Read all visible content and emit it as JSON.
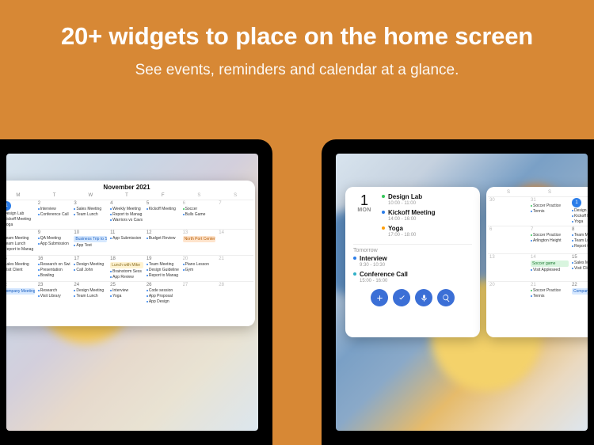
{
  "hero": {
    "title": "20+ widgets to place on the home screen",
    "subtitle": "See events, reminders and calendar at a glance."
  },
  "month": {
    "title": "November 2021",
    "dayHeaders": [
      "M",
      "T",
      "W",
      "T",
      "F",
      "S",
      "S"
    ],
    "weeks": [
      [
        {
          "n": "1",
          "today": true,
          "items": [
            {
              "t": "Design Lab",
              "k": "ev"
            },
            {
              "t": "Kickoff Meeting",
              "k": "ev"
            },
            {
              "t": "Yoga",
              "k": "ev"
            }
          ]
        },
        {
          "n": "2",
          "items": [
            {
              "t": "Interview",
              "k": "ev"
            },
            {
              "t": "Conference Call",
              "k": "ev"
            }
          ]
        },
        {
          "n": "3",
          "items": [
            {
              "t": "Sales Meeting",
              "k": "ev"
            },
            {
              "t": "Team Lunch",
              "k": "ev"
            }
          ]
        },
        {
          "n": "4",
          "items": [
            {
              "t": "Weekly Meeting",
              "k": "ev"
            },
            {
              "t": "Report to Manag",
              "k": "ev"
            },
            {
              "t": "Warriors vs Cavs",
              "k": "ev"
            }
          ]
        },
        {
          "n": "5",
          "items": [
            {
              "t": "Kickoff Meeting",
              "k": "ev"
            }
          ]
        },
        {
          "n": "6",
          "weekend": true,
          "items": [
            {
              "t": "Soccer",
              "k": "ev green"
            },
            {
              "t": "Bulls Game",
              "k": "ev"
            }
          ]
        },
        {
          "n": "7",
          "weekend": true,
          "items": []
        }
      ],
      [
        {
          "n": "8",
          "items": [
            {
              "t": "Team Meeting",
              "k": "ev"
            },
            {
              "t": "Team Lunch",
              "k": "ev"
            },
            {
              "t": "Report to Manag",
              "k": "ev"
            }
          ]
        },
        {
          "n": "9",
          "items": [
            {
              "t": "QA Meeting",
              "k": "ev"
            },
            {
              "t": "App Submission",
              "k": "ev"
            }
          ]
        },
        {
          "n": "10",
          "items": [
            {
              "t": "Business Trip to San Francisco",
              "k": "bar blue",
              "span": 3
            },
            {
              "t": "App Test",
              "k": "ev"
            }
          ]
        },
        {
          "n": "11",
          "items": [
            {
              "t": "App Submission",
              "k": "ev"
            }
          ]
        },
        {
          "n": "12",
          "items": [
            {
              "t": "Budget Review",
              "k": "ev"
            }
          ]
        },
        {
          "n": "13",
          "weekend": true,
          "items": [
            {
              "t": "North Port Center",
              "k": "bar orange"
            }
          ]
        },
        {
          "n": "14",
          "weekend": true,
          "items": []
        }
      ],
      [
        {
          "n": "15",
          "items": [
            {
              "t": "Sales Meeting",
              "k": "ev"
            },
            {
              "t": "Visit Client",
              "k": "ev"
            }
          ]
        },
        {
          "n": "16",
          "items": [
            {
              "t": "Research on Swi",
              "k": "ev"
            },
            {
              "t": "Presentation",
              "k": "ev"
            },
            {
              "t": "Bowling",
              "k": "ev"
            }
          ]
        },
        {
          "n": "17",
          "items": [
            {
              "t": "Design Meeting",
              "k": "ev"
            },
            {
              "t": "Call John",
              "k": "ev"
            }
          ]
        },
        {
          "n": "18",
          "items": [
            {
              "t": "Lunch with Mike",
              "k": "bar yellow"
            },
            {
              "t": "Brainstorm Sess",
              "k": "ev"
            },
            {
              "t": "App Review",
              "k": "ev"
            }
          ]
        },
        {
          "n": "19",
          "items": [
            {
              "t": "Team Meeting",
              "k": "ev"
            },
            {
              "t": "Design Guideline",
              "k": "ev"
            },
            {
              "t": "Report to Manag",
              "k": "ev"
            }
          ]
        },
        {
          "n": "20",
          "weekend": true,
          "items": [
            {
              "t": "Piano Lesson",
              "k": "ev"
            },
            {
              "t": "Gym",
              "k": "ev"
            }
          ]
        },
        {
          "n": "21",
          "weekend": true,
          "items": []
        }
      ],
      [
        {
          "n": "22",
          "items": [
            {
              "t": "Company Meeting",
              "k": "bar blue"
            }
          ]
        },
        {
          "n": "23",
          "items": [
            {
              "t": "Research",
              "k": "ev"
            },
            {
              "t": "Visit Library",
              "k": "ev"
            }
          ]
        },
        {
          "n": "24",
          "items": [
            {
              "t": "Design Meeting",
              "k": "ev"
            },
            {
              "t": "Team Lunch",
              "k": "ev"
            }
          ]
        },
        {
          "n": "25",
          "items": [
            {
              "t": "Interview",
              "k": "ev"
            },
            {
              "t": "Yoga",
              "k": "ev"
            }
          ]
        },
        {
          "n": "26",
          "items": [
            {
              "t": "Code session",
              "k": "ev"
            },
            {
              "t": "App Proposal",
              "k": "ev"
            },
            {
              "t": "App Design",
              "k": "ev"
            }
          ]
        },
        {
          "n": "27",
          "weekend": true,
          "items": []
        },
        {
          "n": "28",
          "weekend": true,
          "items": []
        }
      ]
    ]
  },
  "agenda": {
    "dayNumber": "1",
    "dayOfWeek": "MON",
    "today": [
      {
        "title": "Design Lab",
        "time": "10:00 - 11:00",
        "color": "green"
      },
      {
        "title": "Kickoff Meeting",
        "time": "14:00 - 16:00",
        "color": "blue"
      },
      {
        "title": "Yoga",
        "time": "17:00 - 18:00",
        "color": "orange"
      }
    ],
    "tomorrowLabel": "Tomorrow",
    "tomorrow": [
      {
        "title": "Interview",
        "time": "9:30 - 10:30",
        "color": "blue"
      },
      {
        "title": "Conference Call",
        "time": "15:00 - 16:00",
        "color": "teal"
      }
    ],
    "actions": [
      "plus",
      "check",
      "mic",
      "search"
    ]
  },
  "mini": {
    "headers": [
      "S",
      "S",
      "M"
    ],
    "rows": [
      [
        {
          "n": "30",
          "weekend": true,
          "items": []
        },
        {
          "n": "31",
          "weekend": true,
          "items": [
            {
              "t": "Soccer Practice",
              "k": "ev green"
            },
            {
              "t": "Tennis",
              "k": "ev"
            }
          ]
        },
        {
          "n": "1",
          "today": true,
          "items": [
            {
              "t": "Design Lab",
              "k": "ev"
            },
            {
              "t": "Kickoff Meeting",
              "k": "ev"
            },
            {
              "t": "Yoga",
              "k": "ev"
            }
          ]
        }
      ],
      [
        {
          "n": "6",
          "weekend": true,
          "items": []
        },
        {
          "n": "7",
          "weekend": true,
          "items": [
            {
              "t": "Soccer Practice",
              "k": "ev green"
            },
            {
              "t": "Arlington Height",
              "k": "ev"
            }
          ]
        },
        {
          "n": "8",
          "items": [
            {
              "t": "Team Meeting",
              "k": "ev"
            },
            {
              "t": "Team Lunch",
              "k": "ev"
            },
            {
              "t": "Report to Manag",
              "k": "ev"
            }
          ]
        }
      ],
      [
        {
          "n": "13",
          "weekend": true,
          "items": []
        },
        {
          "n": "14",
          "weekend": true,
          "items": [
            {
              "t": "Soccer game",
              "k": "bar green"
            },
            {
              "t": "Visit Appleseed",
              "k": "ev"
            }
          ]
        },
        {
          "n": "15",
          "items": [
            {
              "t": "Sales Meeting",
              "k": "ev"
            },
            {
              "t": "Visit Client",
              "k": "ev"
            }
          ]
        }
      ],
      [
        {
          "n": "20",
          "weekend": true,
          "items": []
        },
        {
          "n": "21",
          "weekend": true,
          "items": [
            {
              "t": "Soccer Practice",
              "k": "ev green"
            },
            {
              "t": "Tennis",
              "k": "ev"
            }
          ]
        },
        {
          "n": "22",
          "items": [
            {
              "t": "Company Meeting",
              "k": "bar blue"
            }
          ]
        }
      ]
    ]
  }
}
